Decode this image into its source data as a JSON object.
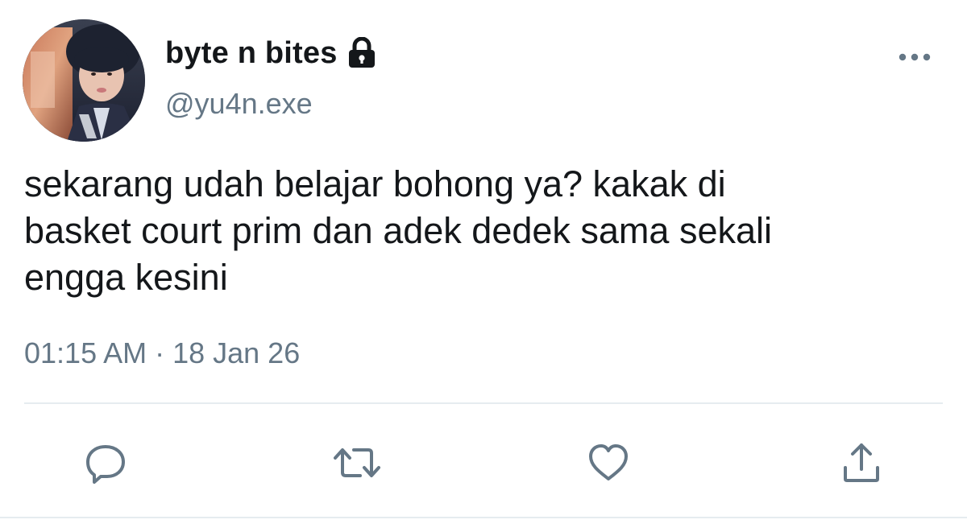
{
  "tweet": {
    "display_name": "byte n bites",
    "handle": "@yu4n.exe",
    "protected_icon": "lock-icon",
    "text": "sekarang udah belajar bohong ya? kakak di\nbasket court prim dan adek dedek sama sekali\nengga kesini",
    "timestamp": "01:15 AM · 18 Jan 26"
  },
  "header": {
    "more_icon": "more-horizontal-icon"
  },
  "actions": [
    {
      "name": "reply",
      "icon": "reply-icon"
    },
    {
      "name": "retweet",
      "icon": "retweet-icon"
    },
    {
      "name": "like",
      "icon": "heart-icon"
    },
    {
      "name": "share",
      "icon": "share-icon"
    }
  ],
  "colors": {
    "text_primary": "#14171a",
    "text_secondary": "#657786",
    "icon_gray": "#657786",
    "divider": "#e6ecf0",
    "background": "#ffffff"
  }
}
